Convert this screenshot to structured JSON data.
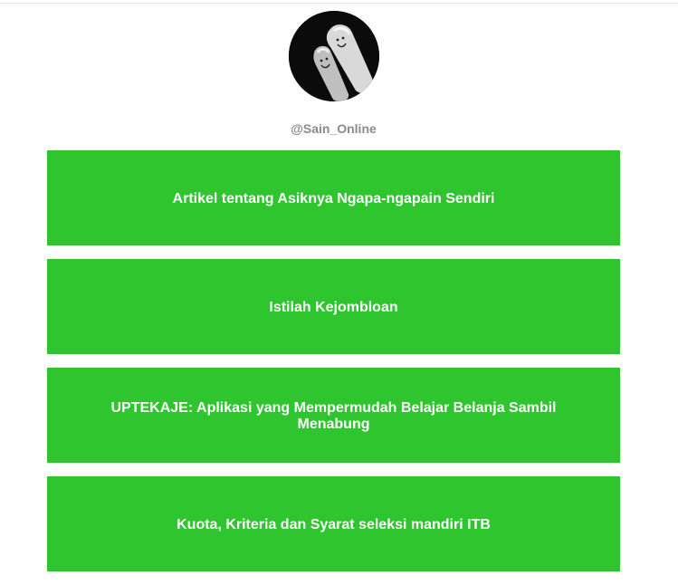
{
  "profile": {
    "username": "@Sain_Online",
    "avatar_icon": "finger-faces-icon"
  },
  "links": [
    {
      "label": "Artikel tentang Asiknya Ngapa-ngapain Sendiri"
    },
    {
      "label": "Istilah Kejombloan"
    },
    {
      "label": "UPTEKAJE: Aplikasi yang Mempermudah Belajar Belanja Sambil Menabung"
    },
    {
      "label": "Kuota, Kriteria dan Syarat seleksi mandiri ITB"
    }
  ],
  "colors": {
    "button": "#2ec52e",
    "button_text": "#ffffff",
    "username": "#8a8a8a"
  }
}
